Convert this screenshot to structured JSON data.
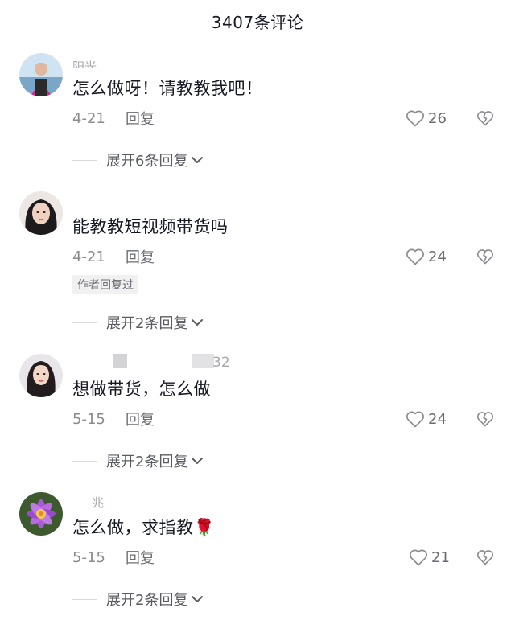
{
  "header": {
    "title": "3407条评论"
  },
  "comments": [
    {
      "username": "阳光",
      "text": "怎么做呀！请教教我吧！",
      "date": "4-21",
      "reply_label": "回复",
      "likes": "26",
      "expand_label": "展开6条回复"
    },
    {
      "username": "",
      "text": "能教教短视频带货吗",
      "date": "4-21",
      "reply_label": "回复",
      "likes": "24",
      "author_tag": "作者回复过",
      "expand_label": "展开2条回复"
    },
    {
      "username": "32",
      "text": "想做带货，怎么做",
      "date": "5-15",
      "reply_label": "回复",
      "likes": "24",
      "expand_label": "展开2条回复"
    },
    {
      "username": "兆",
      "text": "怎么做，求指教🌹",
      "date": "5-15",
      "reply_label": "回复",
      "likes": "21",
      "expand_label": "展开2条回复"
    }
  ],
  "colors": {
    "text": "#161823",
    "meta": "#8a8b91",
    "author_tag_bg": "#f1f1f2"
  },
  "icons": {
    "like": "heart-outline-icon",
    "dislike": "broken-heart-icon",
    "expand": "chevron-down-icon"
  }
}
